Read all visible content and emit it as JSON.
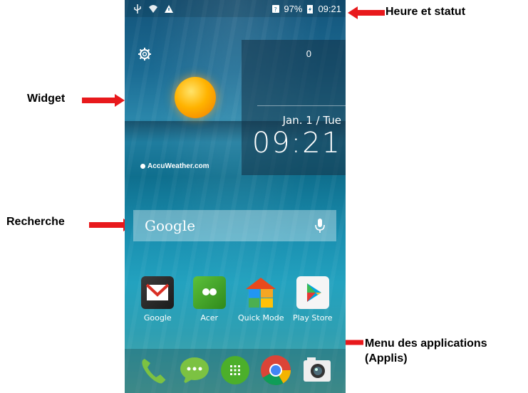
{
  "callouts": {
    "status": "Heure et statut",
    "widget": "Widget",
    "search": "Recherche",
    "apps_menu_line1": "Menu des applications",
    "apps_menu_line2": "(Applis)"
  },
  "statusbar": {
    "battery": "97%",
    "time": "09:21"
  },
  "weather": {
    "provider": "AccuWeather.com"
  },
  "clock": {
    "count": "0",
    "date": "Jan. 1 / Tue",
    "time": "09:21"
  },
  "search": {
    "label": "Google"
  },
  "apps": [
    {
      "label": "Google",
      "icon": "gmail-folder-icon"
    },
    {
      "label": "Acer",
      "icon": "acer-folder-icon"
    },
    {
      "label": "Quick Mode",
      "icon": "quick-mode-house-icon"
    },
    {
      "label": "Play Store",
      "icon": "play-store-icon"
    }
  ],
  "dock": [
    "phone-icon",
    "messaging-icon",
    "app-drawer-icon",
    "chrome-icon",
    "camera-icon"
  ],
  "colors": {
    "arrow": "#e8191c",
    "accent_green": "#4caf2a"
  }
}
